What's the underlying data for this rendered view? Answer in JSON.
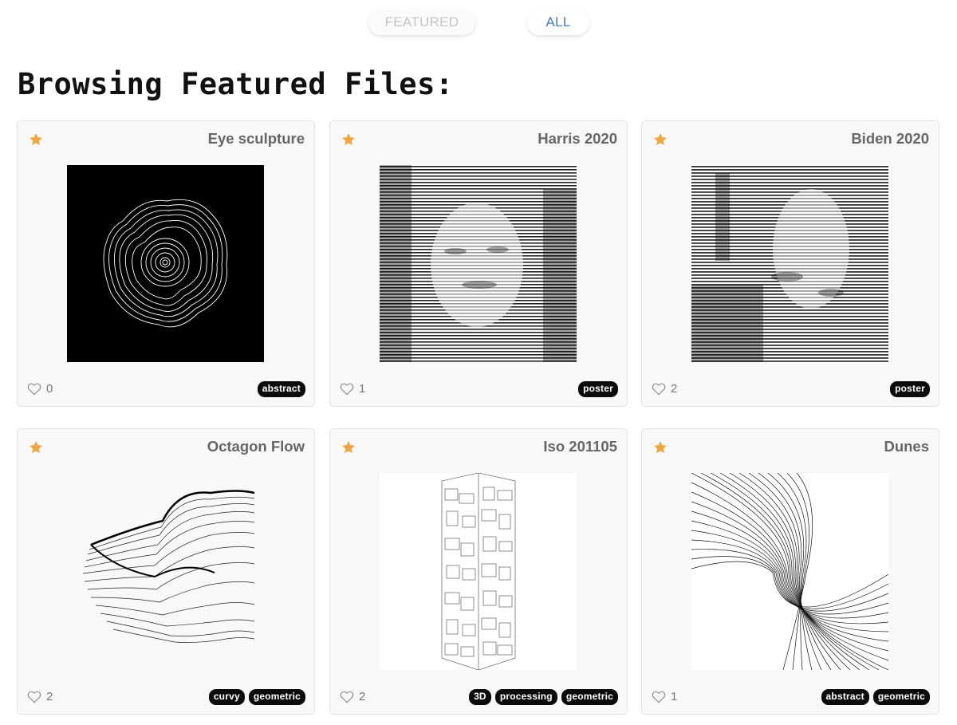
{
  "tabs": {
    "featured_label": "FEATURED",
    "all_label": "ALL",
    "active": "ALL"
  },
  "page_title": "Browsing Featured Files:",
  "colors": {
    "star": "#f0a742",
    "tag_bg": "#0c0c0c",
    "active_tab": "#3f7fd0"
  },
  "icons": {
    "favorite": "star-icon",
    "like": "heart-outline-icon"
  },
  "cards": [
    {
      "title": "Eye sculpture",
      "likes": "0",
      "tags": [
        "abstract"
      ],
      "featured": true
    },
    {
      "title": "Harris 2020",
      "likes": "1",
      "tags": [
        "poster"
      ],
      "featured": true
    },
    {
      "title": "Biden 2020",
      "likes": "2",
      "tags": [
        "poster"
      ],
      "featured": true
    },
    {
      "title": "Octagon Flow",
      "likes": "2",
      "tags": [
        "curvy",
        "geometric"
      ],
      "featured": true
    },
    {
      "title": "Iso 201105",
      "likes": "2",
      "tags": [
        "3D",
        "processing",
        "geometric"
      ],
      "featured": true
    },
    {
      "title": "Dunes",
      "likes": "1",
      "tags": [
        "abstract",
        "geometric"
      ],
      "featured": true
    }
  ]
}
